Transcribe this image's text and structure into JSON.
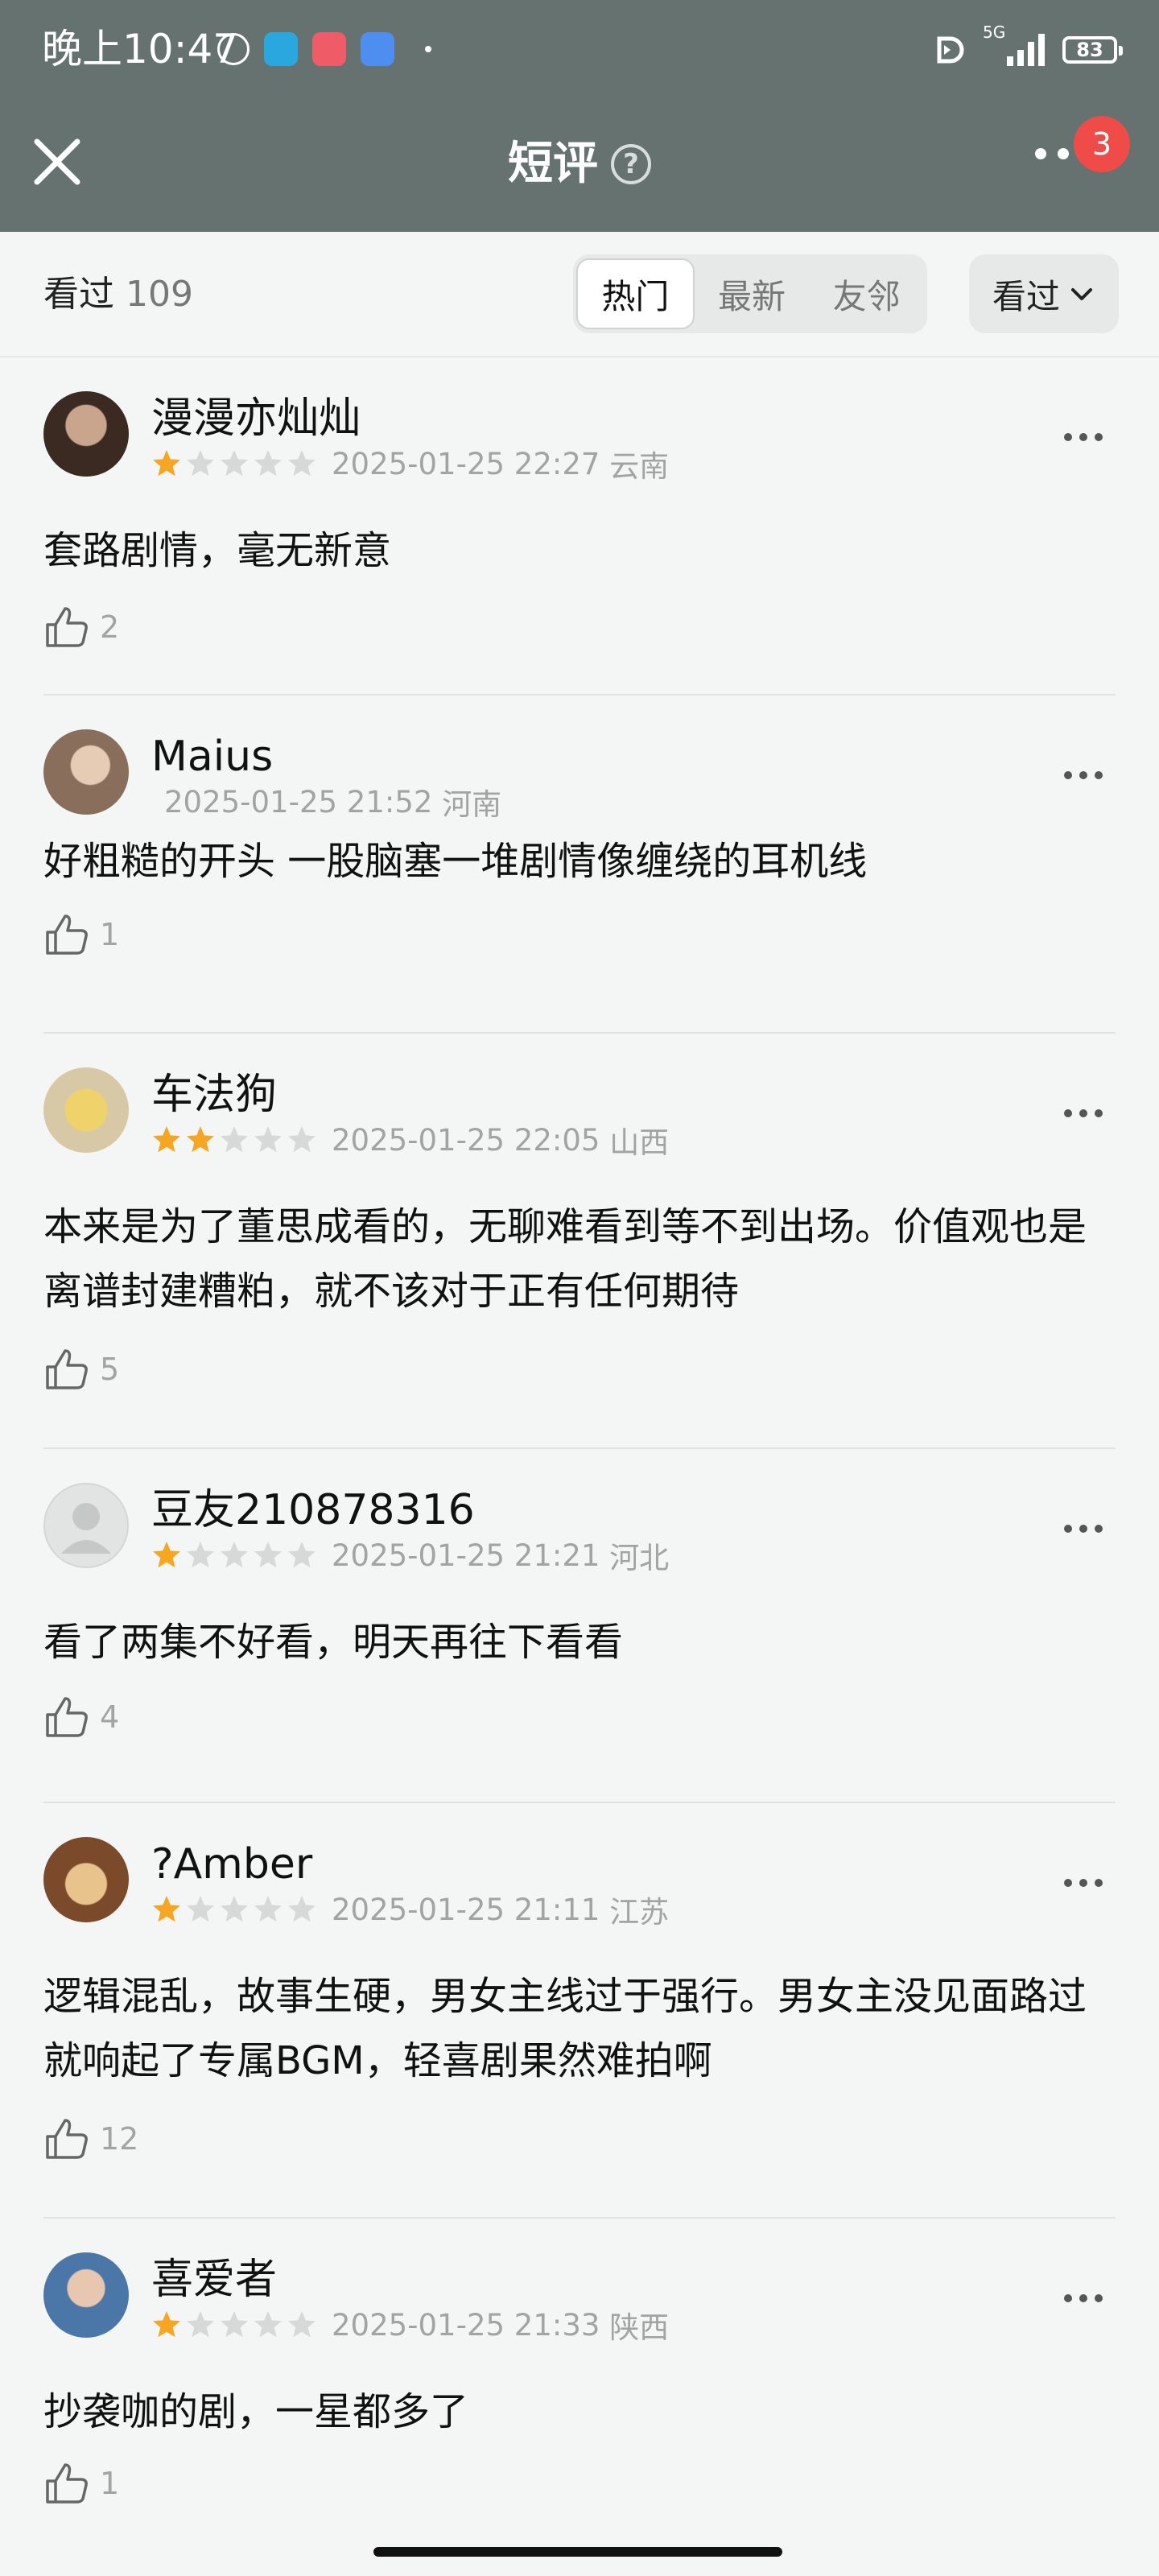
{
  "status_bar": {
    "time": "晚上10:47",
    "network": "5G",
    "battery": "83"
  },
  "header": {
    "title": "短评",
    "help": "?",
    "badge_count": "3"
  },
  "filter": {
    "seen_label": "看过",
    "seen_count": "109",
    "tabs": [
      "热门",
      "最新",
      "友邻"
    ],
    "active_tab": "热门",
    "dropdown": "看过"
  },
  "comments": [
    {
      "user": "漫漫亦灿灿",
      "rating": 1,
      "date": "2025-01-25 22:27",
      "location": "云南",
      "text": "套路剧情，毫无新意",
      "likes": "2"
    },
    {
      "user": "Maius",
      "rating": 0,
      "date": "2025-01-25 21:52",
      "location": "河南",
      "text": "好粗糙的开头 一股脑塞一堆剧情像缠绕的耳机线",
      "likes": "1"
    },
    {
      "user": "车法狗",
      "rating": 2,
      "date": "2025-01-25 22:05",
      "location": "山西",
      "text": "本来是为了董思成看的，无聊难看到等不到出场。价值观也是离谱封建糟粕，就不该对于正有任何期待",
      "likes": "5"
    },
    {
      "user": "豆友210878316",
      "rating": 1,
      "date": "2025-01-25 21:21",
      "location": "河北",
      "text": "看了两集不好看，明天再往下看看",
      "likes": "4"
    },
    {
      "user": "?Amber",
      "rating": 1,
      "date": "2025-01-25 21:11",
      "location": "江苏",
      "text": "逻辑混乱，故事生硬，男女主线过于强行。男女主没见面路过就响起了专属BGM，轻喜剧果然难拍啊",
      "likes": "12"
    },
    {
      "user": "喜爱者",
      "rating": 1,
      "date": "2025-01-25 21:33",
      "location": "陕西",
      "text": "抄袭咖的剧，一星都多了",
      "likes": "1"
    }
  ],
  "colors": {
    "header_bg": "#667270",
    "star_on": "#f6a623",
    "star_off": "#d6d9d8",
    "badge": "#ef4b48"
  },
  "icons": [
    "close-icon",
    "help-icon",
    "more-icon",
    "thumbs-up-icon",
    "chevron-down-icon",
    "star-icon"
  ]
}
